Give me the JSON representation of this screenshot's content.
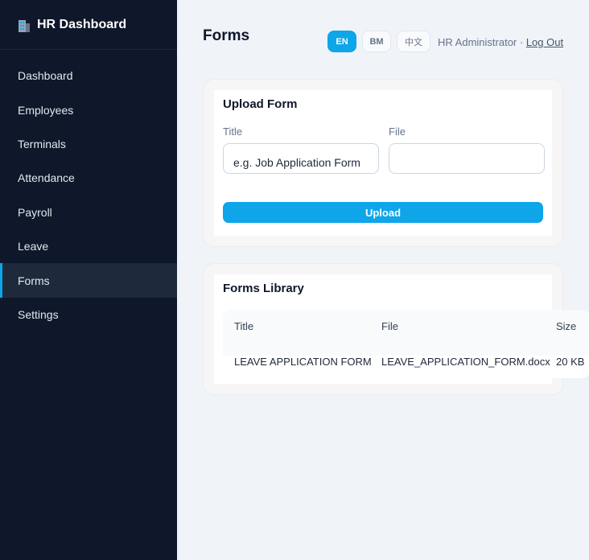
{
  "sidebar": {
    "brand": "HR Dashboard",
    "items": [
      {
        "label": "Dashboard"
      },
      {
        "label": "Employees"
      },
      {
        "label": "Terminals"
      },
      {
        "label": "Attendance"
      },
      {
        "label": "Payroll"
      },
      {
        "label": "Leave"
      },
      {
        "label": "Forms",
        "active": true
      },
      {
        "label": "Settings"
      }
    ]
  },
  "header": {
    "title": "Forms",
    "languages": [
      "EN",
      "BM",
      "中文"
    ],
    "active_language": "EN",
    "user": "HR Administrator ·",
    "logout": "Log Out"
  },
  "upload": {
    "title": "Upload Form",
    "title_label": "Title",
    "title_placeholder": "e.g. Job Application Form",
    "file_label": "File",
    "button": "Upload"
  },
  "library": {
    "title": "Forms Library",
    "columns": [
      "Title",
      "File",
      "Size"
    ],
    "rows": [
      {
        "title": "LEAVE APPLICATION FORM",
        "file": "LEAVE_APPLICATION_FORM.docx",
        "size": "20 KB"
      }
    ]
  },
  "colors": {
    "sidebar_bg": "#0f172a",
    "accent": "#0ea5e9",
    "page_bg": "#f0f3f8"
  }
}
